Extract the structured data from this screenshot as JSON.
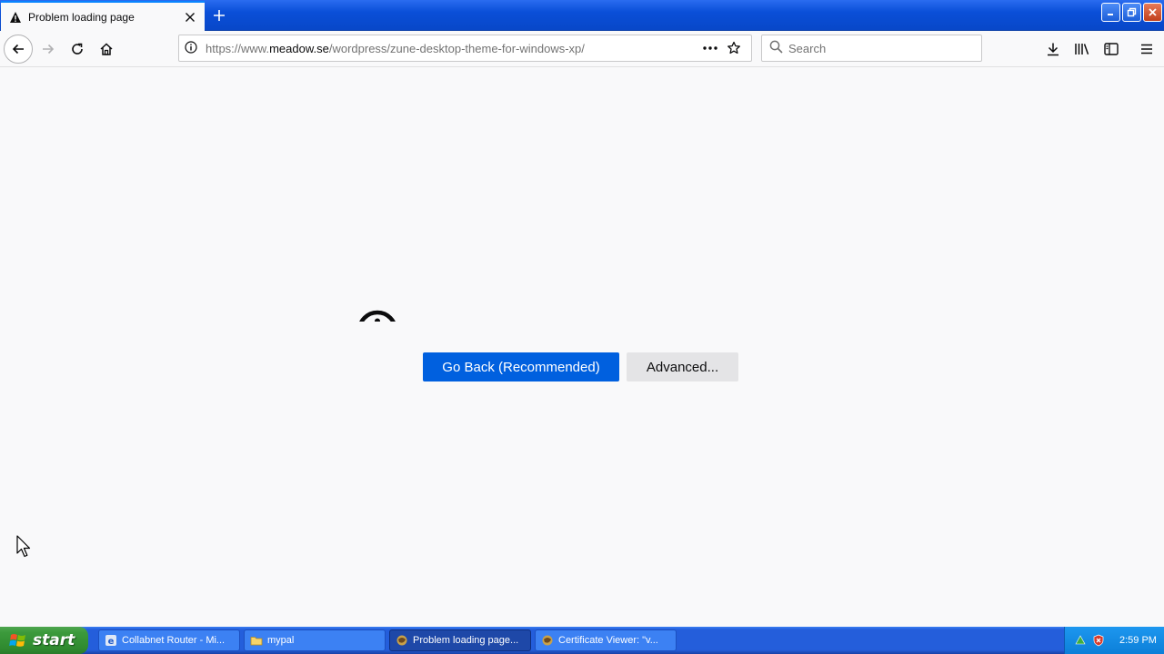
{
  "tab": {
    "title": "Problem loading page",
    "icon": "warning-icon"
  },
  "nav": {
    "url_prefix": "https://www.",
    "url_domain": "meadow.se",
    "url_path": "/wordpress/zune-desktop-theme-for-windows-xp/",
    "search_placeholder": "Search"
  },
  "content": {
    "go_back_label": "Go Back (Recommended)",
    "advanced_label": "Advanced..."
  },
  "taskbar": {
    "start_label": "start",
    "tasks": [
      {
        "label": "Collabnet Router - Mi...",
        "icon": "ie-icon"
      },
      {
        "label": "mypal",
        "icon": "folder-icon"
      },
      {
        "label": "Problem loading page...",
        "icon": "mypal-icon"
      },
      {
        "label": "Certificate Viewer: \"v...",
        "icon": "mypal-icon"
      }
    ],
    "clock": "2:59 PM"
  },
  "colors": {
    "primary_button": "#0060df",
    "secondary_button": "#e4e4e6",
    "tab_accent": "#0a84ff",
    "xp_blue": "#245edb",
    "xp_start_green": "#3c9a3c"
  }
}
